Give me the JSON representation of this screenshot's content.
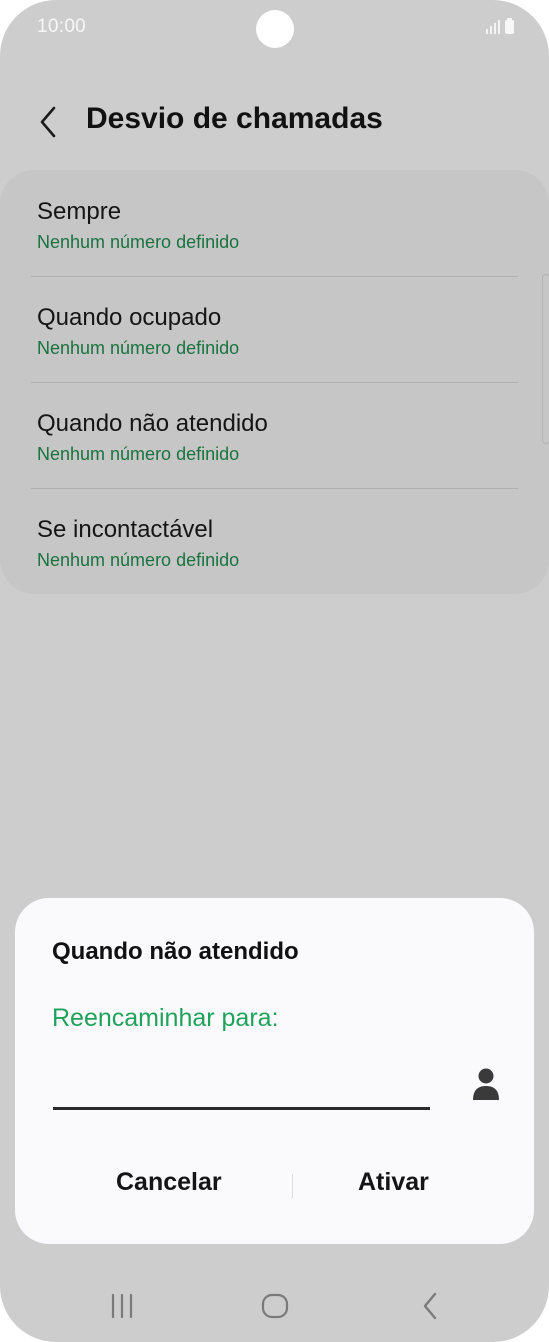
{
  "status_bar": {
    "time": "10:00"
  },
  "header": {
    "back_icon": "chevron-left-icon",
    "title": "Desvio de chamadas"
  },
  "forwarding_options": [
    {
      "title": "Sempre",
      "subtitle": "Nenhum número definido"
    },
    {
      "title": "Quando ocupado",
      "subtitle": "Nenhum número definido"
    },
    {
      "title": "Quando não atendido",
      "subtitle": "Nenhum número definido"
    },
    {
      "title": "Se incontactável",
      "subtitle": "Nenhum número definido"
    }
  ],
  "dialog": {
    "title": "Quando não atendido",
    "label": "Reencaminhar para:",
    "input_value": "",
    "contact_icon": "person-icon",
    "cancel_label": "Cancelar",
    "activate_label": "Ativar"
  },
  "nav_bar": {
    "recents_icon": "recent-apps-icon",
    "home_icon": "home-icon",
    "back_icon": "back-icon"
  },
  "colors": {
    "background": "#cdcdcd",
    "card": "#c6c6c6",
    "subtitle_green": "#19733f",
    "accent_green": "#1fa35a",
    "dialog_bg": "#fafafd"
  }
}
